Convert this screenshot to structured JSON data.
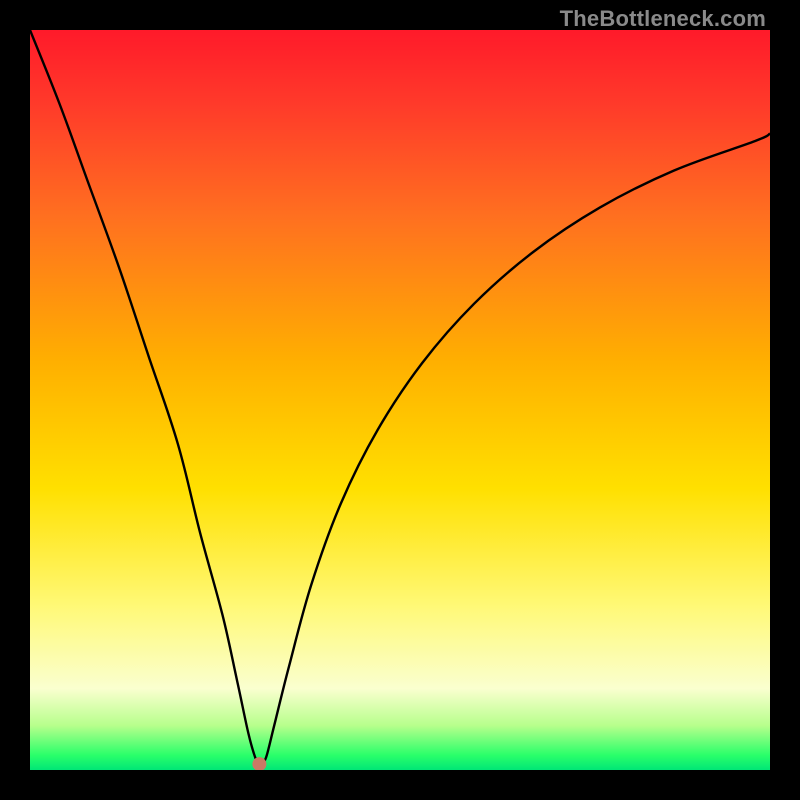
{
  "watermark": "TheBottleneck.com",
  "chart_data": {
    "type": "line",
    "title": "",
    "xlabel": "",
    "ylabel": "",
    "xlim": [
      0,
      100
    ],
    "ylim": [
      0,
      100
    ],
    "background": "spectral-red-to-green-vertical",
    "series": [
      {
        "name": "bottleneck-curve",
        "x": [
          0,
          4,
          8,
          12,
          16,
          20,
          23,
          26,
          28,
          29.5,
          30.5,
          31,
          31.5,
          32,
          33,
          35,
          38,
          42,
          47,
          53,
          60,
          68,
          77,
          87,
          98,
          100
        ],
        "y": [
          100,
          90,
          79,
          68,
          56,
          44,
          32,
          21,
          12,
          5,
          1.5,
          0.8,
          1.0,
          2,
          6,
          14,
          25,
          36,
          46,
          55,
          63,
          70,
          76,
          81,
          85,
          86
        ]
      }
    ],
    "marker": {
      "x_pct": 31.0,
      "y_pct": 0.8,
      "color": "#c97a65",
      "radius_px": 7
    }
  }
}
